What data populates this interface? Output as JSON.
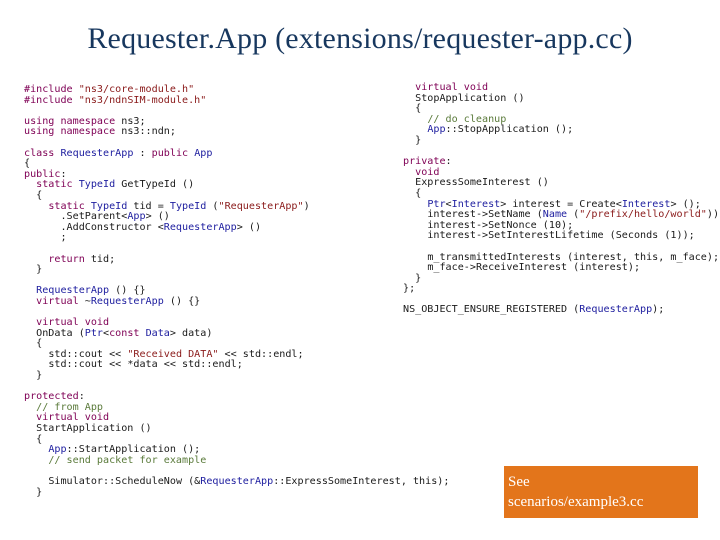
{
  "title": "Requester.App (extensions/requester-app.cc)",
  "code_left": [
    "#include \"ns3/core-module.h\"",
    "#include \"ns3/ndnSIM-module.h\"",
    "",
    "using namespace ns3;",
    "using namespace ns3::ndn;",
    "",
    "class RequesterApp : public App",
    "{",
    "public:",
    "  static TypeId GetTypeId ()",
    "  {",
    "    static TypeId tid = TypeId (\"RequesterApp\")",
    "      .SetParent<App> ()",
    "      .AddConstructor <RequesterApp> ()",
    "      ;",
    "",
    "    return tid;",
    "  }",
    "",
    "  RequesterApp () {}",
    "  virtual ~RequesterApp () {}",
    "",
    "  virtual void",
    "  OnData (Ptr<const Data> data)",
    "  {",
    "    std::cout << \"Received DATA\" << std::endl;",
    "    std::cout << *data << std::endl;",
    "  }",
    "",
    "protected:",
    "  // from App",
    "  virtual void",
    "  StartApplication ()",
    "  {",
    "    App::StartApplication ();",
    "    // send packet for example",
    "",
    "    Simulator::ScheduleNow (&RequesterApp::ExpressSomeInterest, this);",
    "  }"
  ],
  "code_right": [
    "  virtual void",
    "  StopApplication ()",
    "  {",
    "    // do cleanup",
    "    App::StopApplication ();",
    "  }",
    "",
    "private:",
    "  void",
    "  ExpressSomeInterest ()",
    "  {",
    "    Ptr<Interest> interest = Create<Interest> ();",
    "    interest->SetName (Name (\"/prefix/hello/world\"));",
    "    interest->SetNonce (10);",
    "    interest->SetInterestLifetime (Seconds (1));",
    "",
    "    m_transmittedInterests (interest, this, m_face);",
    "    m_face->ReceiveInterest (interest);",
    "  }",
    "};",
    "",
    "NS_OBJECT_ENSURE_REGISTERED (RequesterApp);"
  ],
  "note": {
    "line1": "See",
    "line2": "scenarios/example3.cc"
  },
  "colors": {
    "title": "#17375e",
    "note_bg": "#e3751b",
    "note_text": "#ffffff",
    "keyword": "#7f0055",
    "type": "#2020a0",
    "string": "#8a1a1a",
    "comment": "#5a7a3a"
  }
}
